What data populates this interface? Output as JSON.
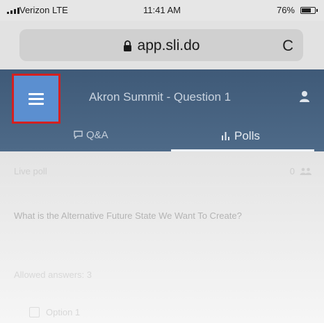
{
  "status_bar": {
    "carrier": "Verizon LTE",
    "time": "11:41 AM",
    "battery_percent": "76%",
    "battery_level": 0.76
  },
  "browser": {
    "url": "app.sli.do",
    "lock_icon": "lock-icon",
    "reload_icon": "reload-icon",
    "reload_glyph": "C"
  },
  "header": {
    "menu_icon": "hamburger-menu-icon",
    "title": "Akron Summit - Question 1",
    "user_icon": "user-icon",
    "highlight_color": "#d42020",
    "menu_button_color": "#5b8fd0",
    "header_color": "#47627f"
  },
  "tabs": [
    {
      "label": "Q&A",
      "icon": "chat-icon",
      "active": false
    },
    {
      "label": "Polls",
      "icon": "poll-icon",
      "active": true
    }
  ],
  "poll": {
    "live_label": "Live poll",
    "participants": "0",
    "question": "What is the Alternative Future State We Want To Create?",
    "allowed_answers": "Allowed answers: 3",
    "options": [
      {
        "label": "Option 1"
      }
    ]
  }
}
